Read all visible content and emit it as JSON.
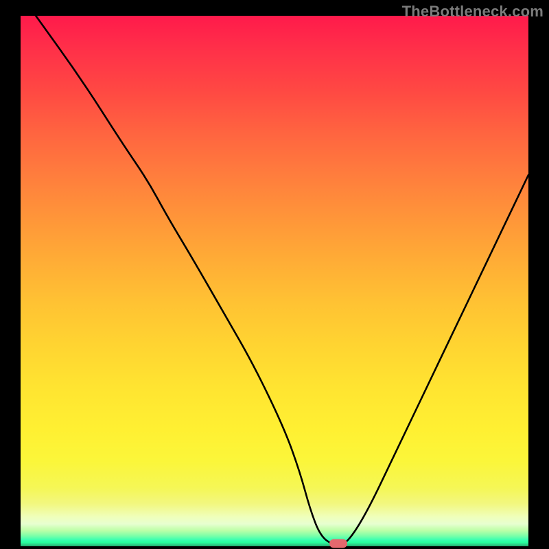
{
  "attribution": "TheBottleneck.com",
  "chart_data": {
    "type": "line",
    "title": "",
    "xlabel": "",
    "ylabel": "",
    "xlim": [
      0,
      100
    ],
    "ylim": [
      0,
      100
    ],
    "grid": false,
    "legend": false,
    "background": "heat-gradient",
    "series": [
      {
        "name": "bottleneck-curve",
        "x": [
          3,
          12,
          20,
          25,
          29,
          34,
          40,
          46,
          52,
          55,
          57,
          59,
          61.5,
          64,
          68,
          74,
          80,
          86,
          92,
          98,
          100
        ],
        "values": [
          100,
          88,
          76,
          69,
          62,
          54,
          44,
          34,
          22,
          14,
          7,
          2,
          0.2,
          0.2,
          6,
          18,
          30,
          42,
          54,
          66,
          70
        ]
      }
    ],
    "marker": {
      "x_pct": 62.5,
      "y_pct": 0.5,
      "color": "#e4686e"
    },
    "gradient_stops": [
      {
        "pos": 0,
        "color": "#ff1a4b"
      },
      {
        "pos": 0.4,
        "color": "#ff9a38"
      },
      {
        "pos": 0.78,
        "color": "#fff032"
      },
      {
        "pos": 0.93,
        "color": "#f2f780"
      },
      {
        "pos": 0.985,
        "color": "#3bffb0"
      },
      {
        "pos": 1.0,
        "color": "#1eae6e"
      }
    ]
  }
}
